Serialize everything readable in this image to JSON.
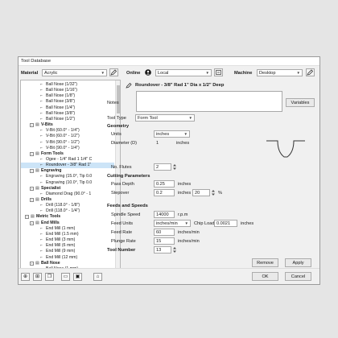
{
  "window_title": "Tool Database",
  "header": {
    "material_label": "Material",
    "material_value": "Acrylic",
    "online_label": "Online",
    "online_value": "Local",
    "machine_label": "Machine",
    "machine_value": "Desktop"
  },
  "tree": {
    "rows": [
      {
        "label": "Ball Nose (1/32\")",
        "indent": 3,
        "toggle": "",
        "bold": false
      },
      {
        "label": "Ball Nose (1/16\")",
        "indent": 3,
        "toggle": "",
        "bold": false
      },
      {
        "label": "Ball Nose (1/8\")",
        "indent": 3,
        "toggle": "",
        "bold": false
      },
      {
        "label": "Ball Nose (3/8\")",
        "indent": 3,
        "toggle": "",
        "bold": false
      },
      {
        "label": "Ball Nose (1/4\")",
        "indent": 3,
        "toggle": "",
        "bold": false
      },
      {
        "label": "Ball Nose (3/8\")",
        "indent": 3,
        "toggle": "",
        "bold": false
      },
      {
        "label": "Ball Nose (1/2\")",
        "indent": 3,
        "toggle": "",
        "bold": false
      },
      {
        "label": "V-Bits",
        "indent": 2,
        "toggle": "-",
        "bold": true
      },
      {
        "label": "V-Bit (60.0° - 1/4\")",
        "indent": 3,
        "toggle": "",
        "bold": false
      },
      {
        "label": "V-Bit (60.0° - 1/2\")",
        "indent": 3,
        "toggle": "",
        "bold": false
      },
      {
        "label": "V-Bit (90.0° - 1/2\")",
        "indent": 3,
        "toggle": "",
        "bold": false
      },
      {
        "label": "V-Bit (90.0° - 1/4\")",
        "indent": 3,
        "toggle": "",
        "bold": false
      },
      {
        "label": "Form Tools",
        "indent": 2,
        "toggle": "-",
        "bold": true
      },
      {
        "label": "Ogee - 1/4\" Rad 1 1/4\" C",
        "indent": 3,
        "toggle": "",
        "bold": false
      },
      {
        "label": "Roundover - 3/8\" Rad 1\"",
        "indent": 3,
        "toggle": "",
        "bold": false,
        "selected": true
      },
      {
        "label": "Engraving",
        "indent": 2,
        "toggle": "-",
        "bold": true
      },
      {
        "label": "Engraving (15.0°, Tip 0.0",
        "indent": 3,
        "toggle": "",
        "bold": false
      },
      {
        "label": "Engraving (10.0°, Tip 0.0",
        "indent": 3,
        "toggle": "",
        "bold": false
      },
      {
        "label": "Specialist",
        "indent": 2,
        "toggle": "-",
        "bold": true
      },
      {
        "label": "Diamond Drag (90.0° - 1",
        "indent": 3,
        "toggle": "",
        "bold": false
      },
      {
        "label": "Drills",
        "indent": 2,
        "toggle": "-",
        "bold": true
      },
      {
        "label": "Drill (118.0° - 1/8\")",
        "indent": 3,
        "toggle": "",
        "bold": false
      },
      {
        "label": "Drill (118.0° - 1/4\")",
        "indent": 3,
        "toggle": "",
        "bold": false
      },
      {
        "label": "Metric Tools",
        "indent": 1,
        "toggle": "-",
        "bold": true
      },
      {
        "label": "End Mills",
        "indent": 2,
        "toggle": "-",
        "bold": true
      },
      {
        "label": "End Mill (1 mm)",
        "indent": 3,
        "toggle": "",
        "bold": false
      },
      {
        "label": "End Mill (1.5 mm)",
        "indent": 3,
        "toggle": "",
        "bold": false
      },
      {
        "label": "End Mill (3 mm)",
        "indent": 3,
        "toggle": "",
        "bold": false
      },
      {
        "label": "End Mill (6 mm)",
        "indent": 3,
        "toggle": "",
        "bold": false
      },
      {
        "label": "End Mill (9 mm)",
        "indent": 3,
        "toggle": "",
        "bold": false
      },
      {
        "label": "End Mill (12 mm)",
        "indent": 3,
        "toggle": "",
        "bold": false
      },
      {
        "label": "Ball Nose",
        "indent": 2,
        "toggle": "-",
        "bold": true
      },
      {
        "label": "Ball Nose (1 mm)",
        "indent": 3,
        "toggle": "",
        "bold": false
      }
    ]
  },
  "tool_name": "Roundover - 3/8\" Rad 1\" Dia x 1/2\" Deep",
  "notes_label": "Notes",
  "variables_button": "Variables",
  "tool_type_label": "Tool Type",
  "tool_type_value": "Form Tool",
  "geometry": {
    "heading": "Geometry",
    "units_label": "Units",
    "units_value": "inches",
    "diameter_label": "Diameter (D)",
    "diameter_value": "1",
    "diameter_unit": "inches",
    "flutes_label": "No. Flutes",
    "flutes_value": "2"
  },
  "cutting": {
    "heading": "Cutting Parameters",
    "pass_depth_label": "Pass Depth",
    "pass_depth_value": "0.25",
    "pass_depth_unit": "inches",
    "stepover_label": "Stepover",
    "stepover_value": "0.2",
    "stepover_unit": "inches",
    "stepover_pct_value": "20",
    "stepover_pct_unit": "%"
  },
  "feeds": {
    "heading": "Feeds and Speeds",
    "spindle_label": "Spindle Speed",
    "spindle_value": "14000",
    "spindle_unit": "r.p.m",
    "feed_units_label": "Feed Units",
    "feed_units_value": "inches/min",
    "chip_load_label": "Chip Load",
    "chip_load_value": "0.0021",
    "chip_load_unit": "inches",
    "feed_rate_label": "Feed Rate",
    "feed_rate_value": "60",
    "feed_rate_unit": "inches/min",
    "plunge_rate_label": "Plunge Rate",
    "plunge_rate_value": "15",
    "plunge_rate_unit": "inches/min"
  },
  "tool_number": {
    "label": "Tool Number",
    "value": "13"
  },
  "buttons": {
    "remove": "Remove",
    "apply": "Apply",
    "ok": "OK",
    "cancel": "Cancel"
  }
}
